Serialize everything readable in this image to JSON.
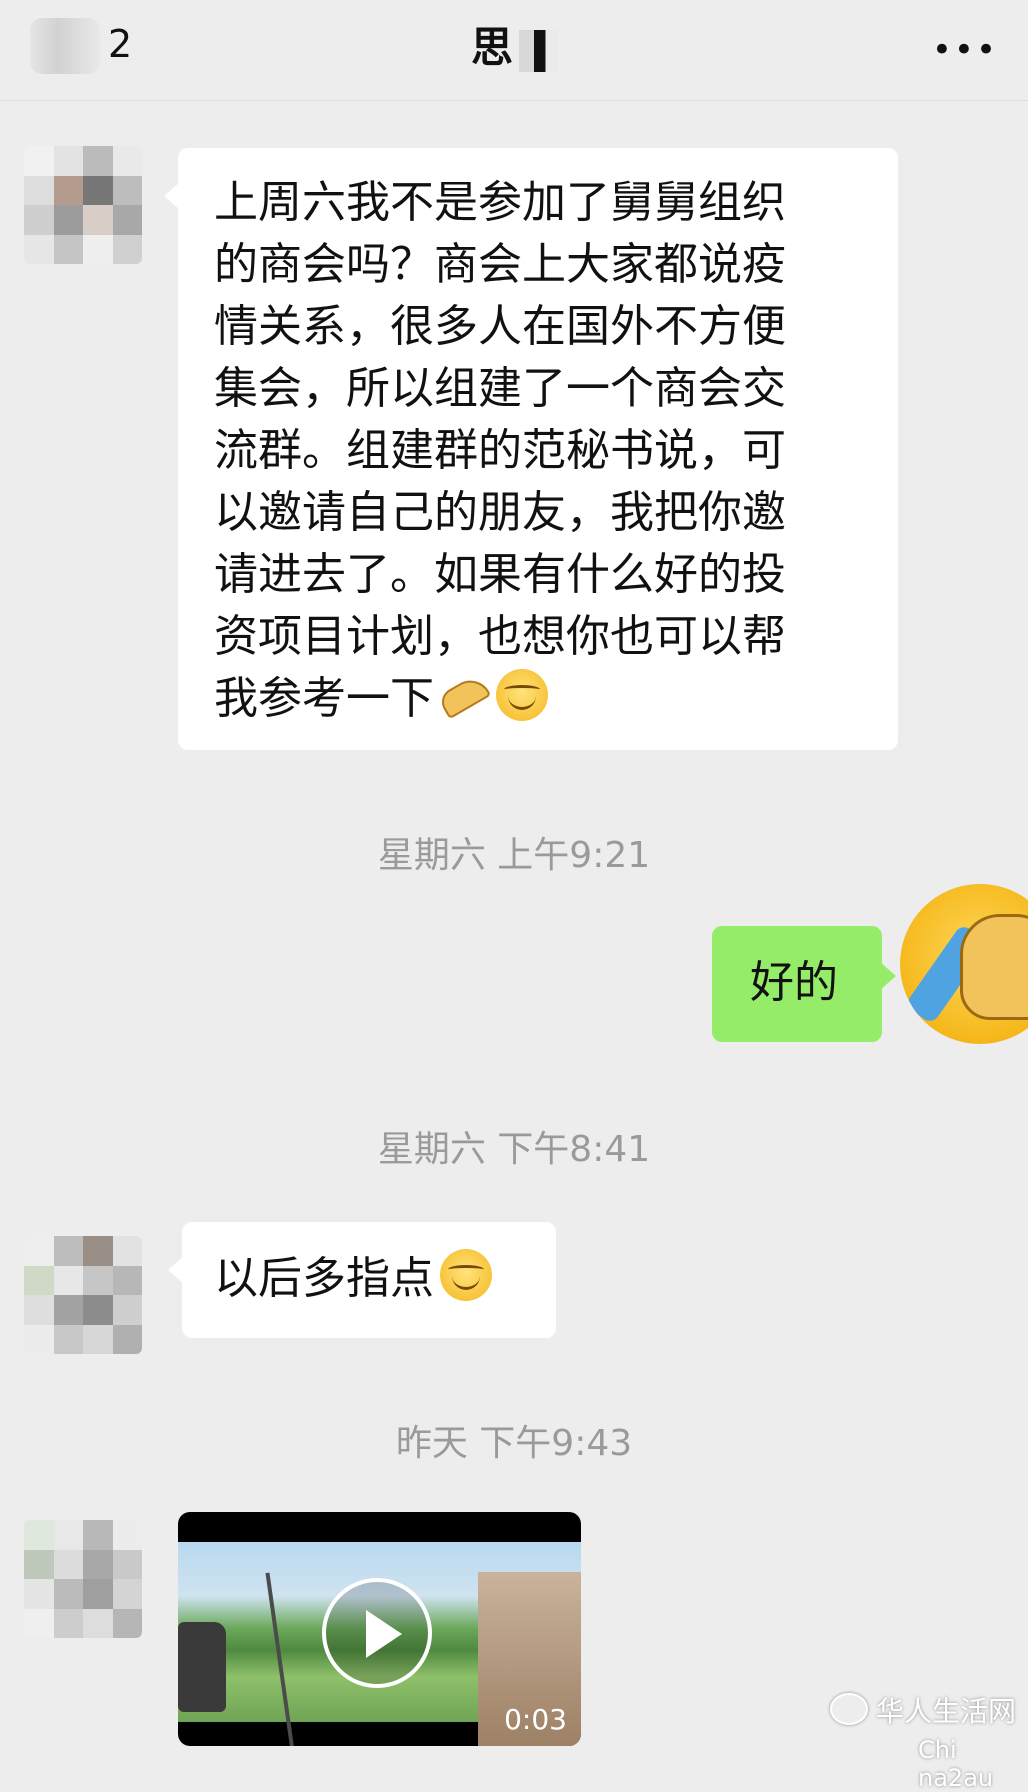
{
  "header": {
    "back_count": "2",
    "title": "思",
    "more_label": "•••"
  },
  "messages": [
    {
      "text": "上周六我不是参加了舅舅组织\n的商会吗？商会上大家都说疫\n情关系，很多人在国外不方便\n集会，所以组建了一个商会交\n流群。组建群的范秘书说，可\n以邀请自己的朋友，我把你邀\n请进去了。如果有什么好的投\n资项目计划，也想你也可以帮\n我参考一下"
    }
  ],
  "time1": "星期六 上午9:21",
  "mine_message": "好的",
  "time2": "星期六 下午8:41",
  "message2": "以后多指点",
  "time3": "昨天 下午9:43",
  "video": {
    "duration": "0:03"
  },
  "watermark": {
    "name": "华人生活网",
    "sub": "Chi na2au"
  },
  "icons": [
    "back-avatar-blur",
    "more-dots-icon",
    "pray-emoji-icon",
    "smile-emoji-icon",
    "play-icon",
    "wechat-icon"
  ]
}
